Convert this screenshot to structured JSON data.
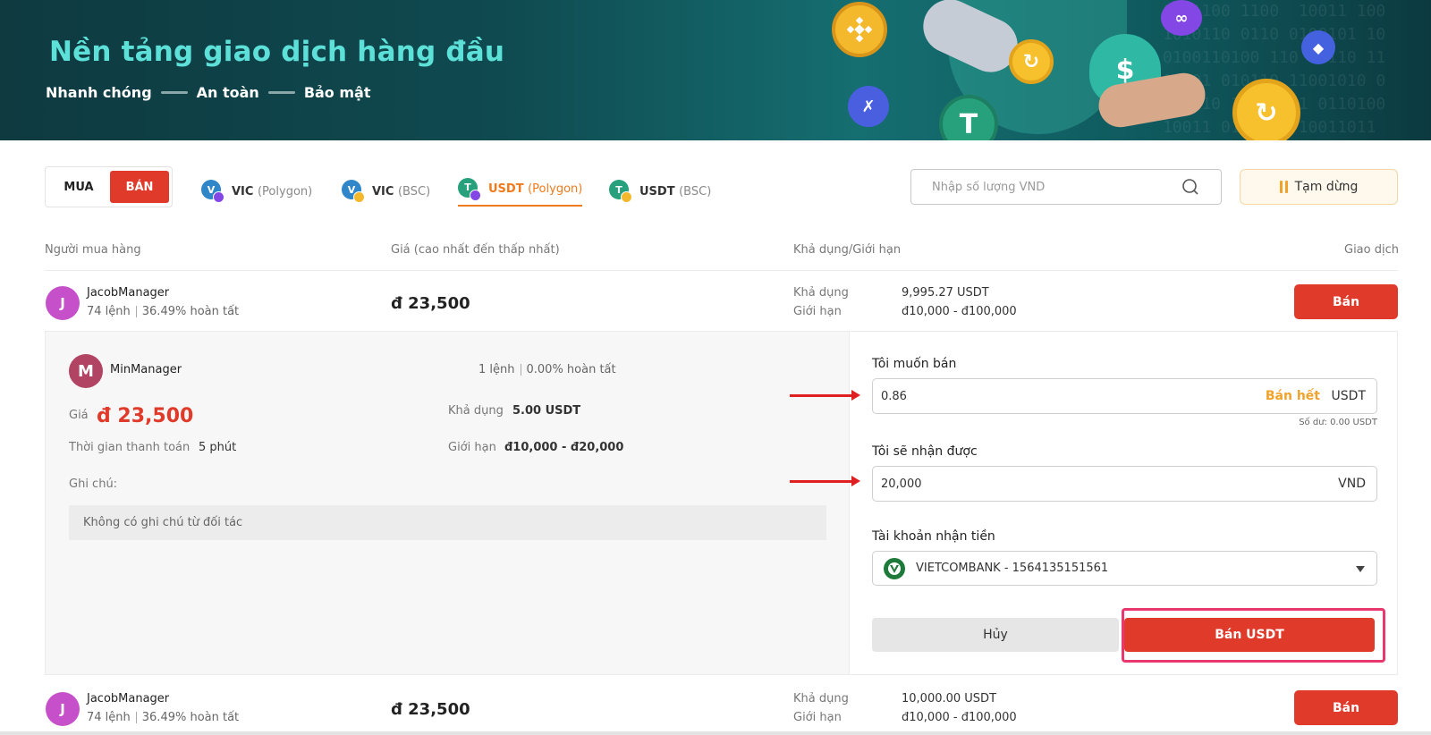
{
  "banner": {
    "title": "Nền tảng giao dịch hàng đầu",
    "tagline": [
      "Nhanh chóng",
      "An toàn",
      "Bảo mật"
    ]
  },
  "mode_toggle": {
    "buy_label": "MUA",
    "sell_label": "BÁN",
    "selected": "BÁN"
  },
  "token_tabs": [
    {
      "name": "VIC",
      "network": "(Polygon)",
      "active": false
    },
    {
      "name": "VIC",
      "network": "(BSC)",
      "active": false
    },
    {
      "name": "USDT",
      "network": "(Polygon)",
      "active": true
    },
    {
      "name": "USDT",
      "network": "(BSC)",
      "active": false
    }
  ],
  "search": {
    "placeholder": "Nhập số lượng VND",
    "value": ""
  },
  "pause_button": {
    "label": "Tạm dừng"
  },
  "table": {
    "headers": {
      "buyer": "Người mua hàng",
      "price": "Giá (cao nhất đến thấp nhất)",
      "available": "Khả dụng/Giới hạn",
      "action": "Giao dịch"
    },
    "rows": [
      {
        "initial": "J",
        "name": "JacobManager",
        "orders": "74 lệnh",
        "completion": "36.49% hoàn tất",
        "price": "đ 23,500",
        "available_label": "Khả dụng",
        "available": "9,995.27 USDT",
        "limit_label": "Giới hạn",
        "limit": "đ10,000 - đ100,000",
        "action_label": "Bán"
      },
      {
        "initial": "J",
        "name": "JacobManager",
        "orders": "74 lệnh",
        "completion": "36.49% hoàn tất",
        "price": "đ 23,500",
        "available_label": "Khả dụng",
        "available": "10,000.00 USDT",
        "limit_label": "Giới hạn",
        "limit": "đ10,000 - đ100,000",
        "action_label": "Bán"
      }
    ]
  },
  "expanded": {
    "initial": "M",
    "name": "MinManager",
    "orders": "1 lệnh",
    "completion": "0.00% hoàn tất",
    "price_label": "Giá",
    "price": "đ 23,500",
    "pay_time_label": "Thời gian thanh toán",
    "pay_time": "5 phút",
    "available_label": "Khả dụng",
    "available": "5.00 USDT",
    "limit_label": "Giới hạn",
    "limit": "đ10,000 - đ20,000",
    "note_label": "Ghi chú:",
    "note": "Không có ghi chú từ đối tác",
    "form": {
      "sell_label": "Tôi muốn bán",
      "sell_value": "0.86",
      "sell_max": "Bán hết",
      "sell_unit": "USDT",
      "balance": "Số dư: 0.00 USDT",
      "receive_label": "Tôi sẽ nhận được",
      "receive_value": "20,000",
      "receive_unit": "VND",
      "account_label": "Tài khoản nhận tiền",
      "account_value": "VIETCOMBANK - 1564135151561",
      "cancel_label": "Hủy",
      "confirm_label": "Bán USDT"
    }
  },
  "colors": {
    "primary_red": "#e03a2b",
    "accent_orange": "#f07a1c",
    "banner_teal": "#5de0d8",
    "highlight_pink": "#e8386e"
  }
}
